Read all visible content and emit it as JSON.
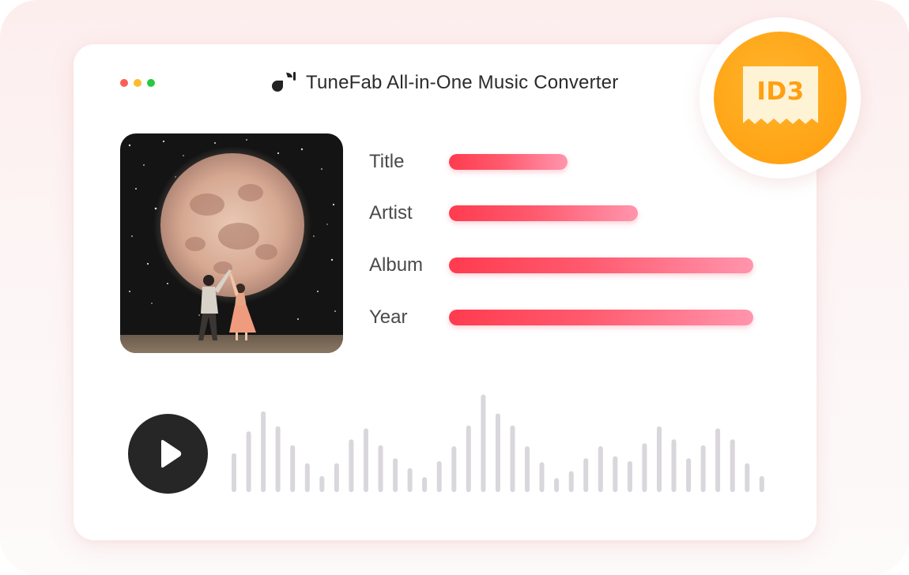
{
  "window": {
    "title": "TuneFab All-in-One Music Converter",
    "traffic_lights": [
      "#fd5f57",
      "#fdbc2e",
      "#28c840"
    ]
  },
  "cover_art": {
    "icon": "album-cover-moon-dancing-couple"
  },
  "metadata": [
    {
      "label": "Title",
      "fill_fraction": 0.39
    },
    {
      "label": "Artist",
      "fill_fraction": 0.62
    },
    {
      "label": "Album",
      "fill_fraction": 1.0
    },
    {
      "label": "Year",
      "fill_fraction": 1.0
    }
  ],
  "player": {
    "play_icon": "play-icon",
    "waveform_levels": [
      0.39,
      0.61,
      0.81,
      0.66,
      0.47,
      0.29,
      0.16,
      0.29,
      0.53,
      0.64,
      0.47,
      0.34,
      0.24,
      0.15,
      0.31,
      0.46,
      0.67,
      0.98,
      0.79,
      0.67,
      0.46,
      0.3,
      0.14,
      0.21,
      0.34,
      0.46,
      0.36,
      0.31,
      0.49,
      0.66,
      0.53,
      0.34,
      0.47,
      0.64,
      0.53,
      0.29,
      0.16
    ]
  },
  "badge": {
    "text": "ID3",
    "color": "#ffa71a"
  },
  "colors": {
    "accent_bar": "#ff4d61",
    "waveform": "#d9d6dc",
    "play_button": "#262626"
  }
}
